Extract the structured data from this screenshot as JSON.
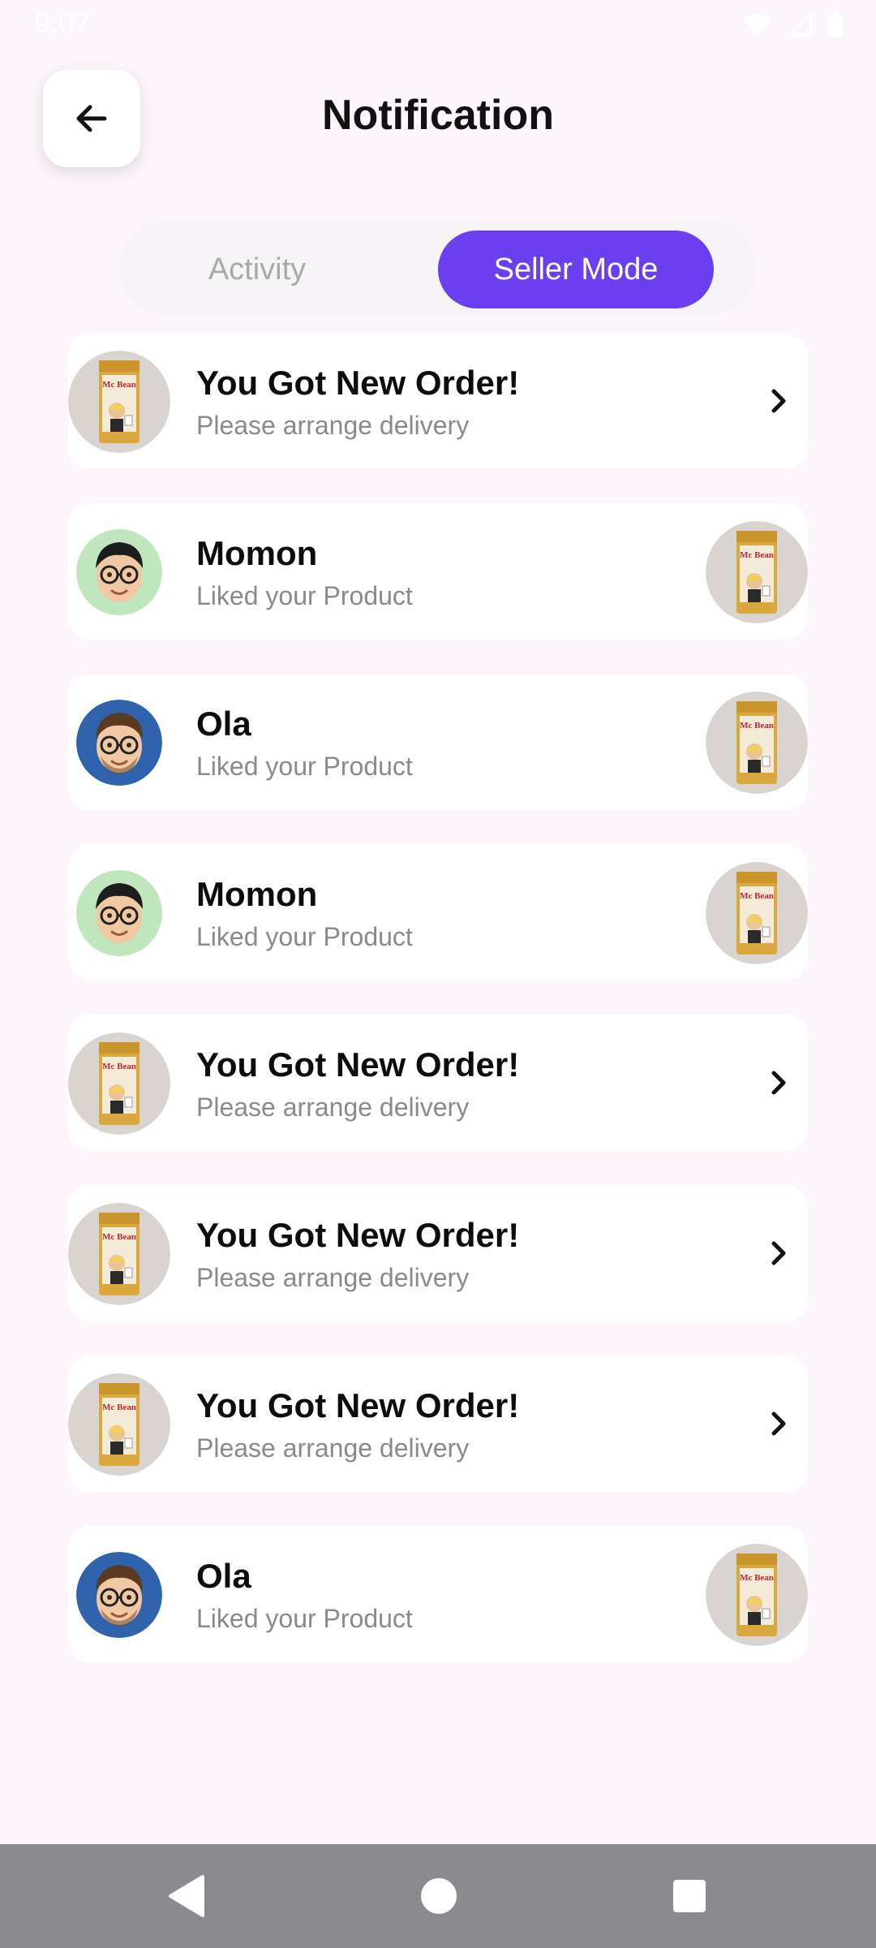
{
  "status_bar": {
    "time": "9:07"
  },
  "header": {
    "title": "Notification"
  },
  "tabs": [
    {
      "label": "Activity",
      "active": false
    },
    {
      "label": "Seller Mode",
      "active": true
    }
  ],
  "colors": {
    "accent": "#6b3ff0",
    "background": "#fdf5fc",
    "nav_bar": "#8b8a8f"
  },
  "notifications": [
    {
      "type": "order",
      "title": "You Got New Order!",
      "subtitle": "Please arrange delivery",
      "icon": "chevron-right-icon"
    },
    {
      "type": "like",
      "title": "Momon",
      "subtitle": "Liked your Product",
      "avatar": "memoji-green"
    },
    {
      "type": "like",
      "title": "Ola",
      "subtitle": "Liked your Product",
      "avatar": "memoji-blue"
    },
    {
      "type": "like",
      "title": "Momon",
      "subtitle": "Liked your Product",
      "avatar": "memoji-green"
    },
    {
      "type": "order",
      "title": "You Got New Order!",
      "subtitle": "Please arrange delivery",
      "icon": "chevron-right-icon"
    },
    {
      "type": "order",
      "title": "You Got New Order!",
      "subtitle": "Please arrange delivery",
      "icon": "chevron-right-icon"
    },
    {
      "type": "order",
      "title": "You Got New Order!",
      "subtitle": "Please arrange delivery",
      "icon": "chevron-right-icon"
    },
    {
      "type": "like",
      "title": "Ola",
      "subtitle": "Liked your Product",
      "avatar": "memoji-blue"
    }
  ],
  "product_logo_text": "Mc Bean",
  "nav": {
    "back": "back-icon",
    "home": "home-icon",
    "recents": "recents-icon"
  }
}
